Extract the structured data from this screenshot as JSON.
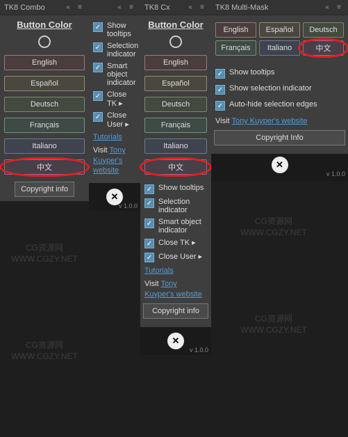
{
  "panels": {
    "combo": {
      "title": "TK8 Combo"
    },
    "cx": {
      "title": "TK8 Cx"
    },
    "mm": {
      "title": "TK8 Multi-Mask"
    }
  },
  "heading": "Button Color",
  "langs": {
    "en": "English",
    "es": "Español",
    "de": "Deutsch",
    "fr": "Français",
    "it": "Italiano",
    "zh": "中文"
  },
  "opts": {
    "tooltips": "Show tooltips",
    "selind": "Selection indicator",
    "smart": "Smart object indicator",
    "closetk": "Close TK ▸",
    "closeuser": "Close User ▸",
    "showsel": "Show selection indicator",
    "autohide": "Auto-hide selection edges"
  },
  "tutorials": "Tutorials",
  "visit": "Visit ",
  "website": "Tony Kuyper's website",
  "copyright": "Copyright info",
  "copyright_cap": "Copyright Info",
  "version": "v 1.0.0",
  "wm1": "CG资源网",
  "wm2": "WWW.CGZY.NET"
}
